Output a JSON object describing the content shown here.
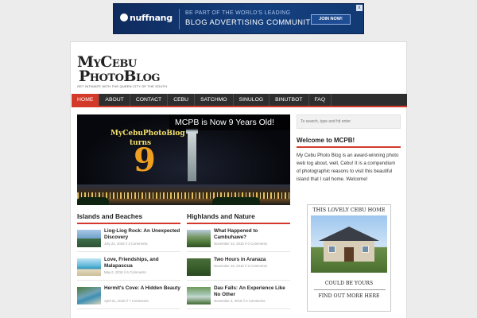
{
  "ad": {
    "brand": "nuffnang",
    "line1": "BE PART OF THE WORLD'S LEADING",
    "line2": "BLOG ADVERTISING COMMUNITY",
    "button": "JOIN NOW!",
    "close": "x"
  },
  "logo": {
    "line1": "MyCebu",
    "line2": "PhotoBlog",
    "tagline": "GET INTIMATE WITH THE QUEEN CITY OF THE SOUTH"
  },
  "nav": {
    "items": [
      "HOME",
      "ABOUT",
      "CONTACT",
      "CEBU",
      "SATCHMO",
      "SINULOG",
      "BINUTBOT",
      "FAQ"
    ],
    "active_color": "#d43a2a"
  },
  "slider": {
    "title": "MCPB is Now 9 Years Old!",
    "art_line1": "MyCebuPhotoBlog",
    "art_line2": "turns",
    "art_number": "9"
  },
  "sections": [
    {
      "heading": "Islands and Beaches",
      "posts": [
        {
          "title": "Liog-Liog Rock: An Unexpected Discovery",
          "meta": "July 22, 2015 // 3 Comments"
        },
        {
          "title": "Love, Friendships, and Malapascua",
          "meta": "May 6, 2015 // 6 Comments"
        },
        {
          "title": "Hermit's Cove: A Hidden Beauty",
          "meta": "April 21, 2015 // 7 Comments"
        }
      ]
    },
    {
      "heading": "Highlands and Nature",
      "posts": [
        {
          "title": "What Happened to Cambuhawe?",
          "meta": "November 24, 2015 // 0 Comments"
        },
        {
          "title": "Two Hours in Aranaza",
          "meta": "November 16, 2015 // 5 Comments"
        },
        {
          "title": "Dau Falls: An Experience Like No Other",
          "meta": "November 3, 2015 // 5 Comments"
        }
      ]
    }
  ],
  "sidebar": {
    "search_placeholder": "To search, type and hit enter",
    "welcome_heading": "Welcome to MCPB!",
    "welcome_text": "My Cebu Photo Blog is an award-winning photo web log about, well, Cebu! It is a compendium of photographic reasons to visit this beautiful island that I call home. Welcome!",
    "ad_top": "THIS LOVELY CEBU HOME",
    "ad_mid": "COULD BE YOURS",
    "ad_bottom": "FIND OUT MORE HERE"
  }
}
